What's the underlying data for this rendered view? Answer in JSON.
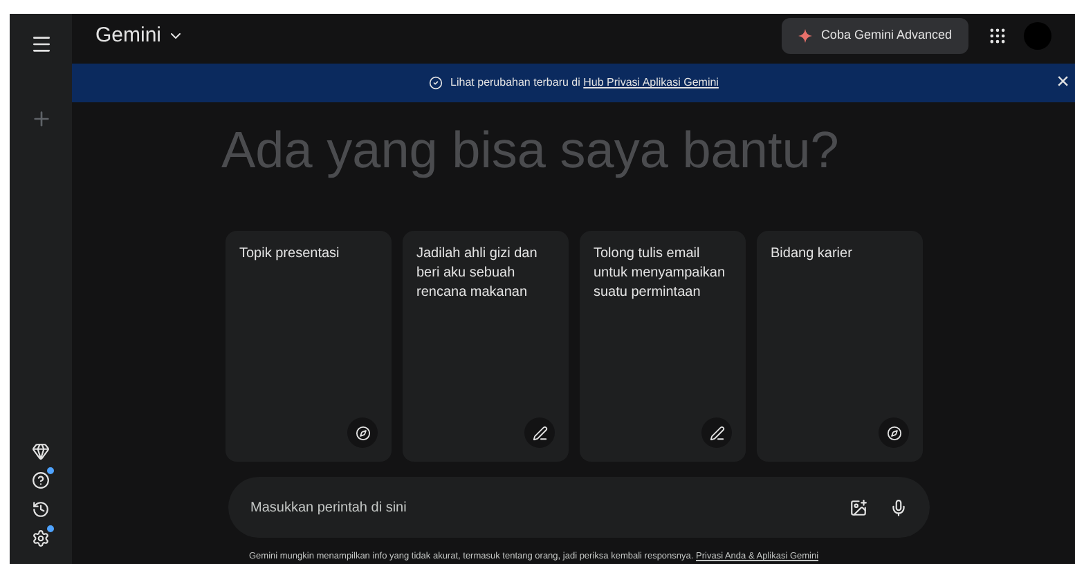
{
  "header": {
    "title": "Gemini",
    "upgrade_button": "Coba Gemini Advanced"
  },
  "banner": {
    "text": "Lihat perubahan terbaru di",
    "link": "Hub Privasi Aplikasi Gemini",
    "close": "×"
  },
  "heading": "Ada yang bisa saya bantu?",
  "cards": [
    {
      "text": "Topik presentasi",
      "kind": "explore"
    },
    {
      "text": "Jadilah ahli gizi dan beri aku sebuah rencana makanan",
      "kind": "write"
    },
    {
      "text": "Tolong tulis email untuk menyampaikan suatu permintaan",
      "kind": "write"
    },
    {
      "text": "Bidang karier",
      "kind": "explore"
    }
  ],
  "prompt": {
    "placeholder": "Masukkan perintah di sini"
  },
  "footer": {
    "text": "Gemini mungkin menampilkan info yang tidak akurat, termasuk tentang orang, jadi periksa kembali responsnya.",
    "link": "Privasi Anda & Aplikasi Gemini"
  },
  "sidebar": {
    "items": [
      {
        "kind": "gem",
        "badge": false
      },
      {
        "kind": "help",
        "badge": true
      },
      {
        "kind": "history",
        "badge": false
      },
      {
        "kind": "settings",
        "badge": true
      }
    ]
  }
}
